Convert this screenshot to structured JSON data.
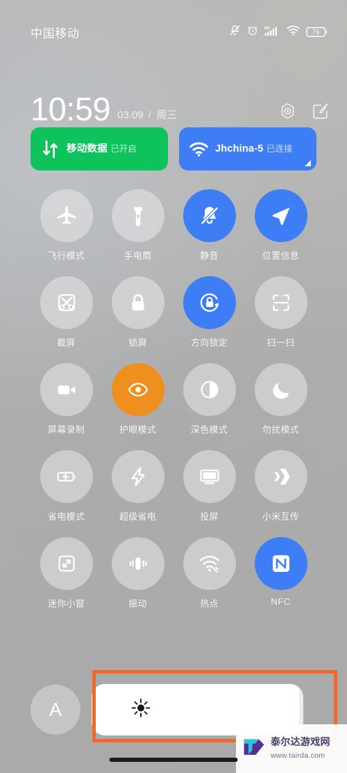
{
  "statusbar": {
    "carrier": "中国移动",
    "battery_level": "76",
    "icons": [
      "mute-bell-icon",
      "alarm-clock-icon",
      "hd-signal-icon",
      "wifi-icon",
      "battery-icon"
    ]
  },
  "header": {
    "time": "10:59",
    "date": "03.09",
    "separator": "/",
    "weekday": "周三",
    "settings_icon": "settings-hex-icon",
    "edit_icon": "edit-pencil-icon"
  },
  "big_tiles": [
    {
      "name": "mobile-data",
      "title": "移动数据",
      "subtitle": "已开启",
      "color": "#0ec35c",
      "icon": "data-arrows-icon",
      "expandable": false
    },
    {
      "name": "wifi",
      "title": "Jhchina-5",
      "subtitle": "已连接",
      "color": "#3d7ef6",
      "icon": "wifi-icon",
      "expandable": true
    }
  ],
  "toggles": [
    {
      "label": "飞行模式",
      "icon": "airplane-icon",
      "state": "off",
      "latin": false
    },
    {
      "label": "手电筒",
      "icon": "flashlight-icon",
      "state": "off",
      "latin": false
    },
    {
      "label": "静音",
      "icon": "mute-bell-icon",
      "state": "blue",
      "latin": false
    },
    {
      "label": "位置信息",
      "icon": "location-arrow-icon",
      "state": "blue",
      "latin": false
    },
    {
      "label": "截屏",
      "icon": "screenshot-icon",
      "state": "off",
      "latin": false
    },
    {
      "label": "锁屏",
      "icon": "lock-icon",
      "state": "off",
      "latin": false
    },
    {
      "label": "方向锁定",
      "icon": "rotation-lock-icon",
      "state": "blue",
      "latin": false
    },
    {
      "label": "扫一扫",
      "icon": "scan-icon",
      "state": "off",
      "latin": false
    },
    {
      "label": "屏幕录制",
      "icon": "video-camera-icon",
      "state": "off",
      "latin": false
    },
    {
      "label": "护眼模式",
      "icon": "eye-icon",
      "state": "orange",
      "latin": false
    },
    {
      "label": "深色模式",
      "icon": "contrast-circle-icon",
      "state": "off",
      "latin": false
    },
    {
      "label": "勿扰模式",
      "icon": "moon-icon",
      "state": "off",
      "latin": false
    },
    {
      "label": "省电模式",
      "icon": "battery-plus-icon",
      "state": "off",
      "latin": false
    },
    {
      "label": "超级省电",
      "icon": "lightning-bolt-icon",
      "state": "off",
      "latin": false
    },
    {
      "label": "投屏",
      "icon": "cast-screen-icon",
      "state": "off",
      "latin": false
    },
    {
      "label": "小米互传",
      "icon": "mi-share-icon",
      "state": "off",
      "latin": false
    },
    {
      "label": "迷你小窗",
      "icon": "mini-window-icon",
      "state": "off",
      "latin": false
    },
    {
      "label": "振动",
      "icon": "vibrate-icon",
      "state": "off",
      "latin": false
    },
    {
      "label": "热点",
      "icon": "hotspot-icon",
      "state": "off",
      "latin": false
    },
    {
      "label": "NFC",
      "icon": "nfc-icon",
      "state": "blue",
      "latin": true
    }
  ],
  "brightness": {
    "auto_label": "A",
    "auto_icon": "auto-brightness-icon",
    "slider_icon": "sun-brightness-icon",
    "fill_percent": 98
  },
  "annotation": {
    "color": "#f2682a",
    "target": "brightness-slider"
  },
  "watermark": {
    "site_name": "泰尔达游戏网",
    "url": "www.tairda.com",
    "logo_icon": "tairda-shield-t-icon"
  },
  "colors": {
    "accent_blue": "#3d7ef6",
    "accent_green": "#0ec35c",
    "accent_orange": "#ef8f1e",
    "annotation_orange": "#f2682a",
    "background_gray": "#b0b0b0"
  }
}
